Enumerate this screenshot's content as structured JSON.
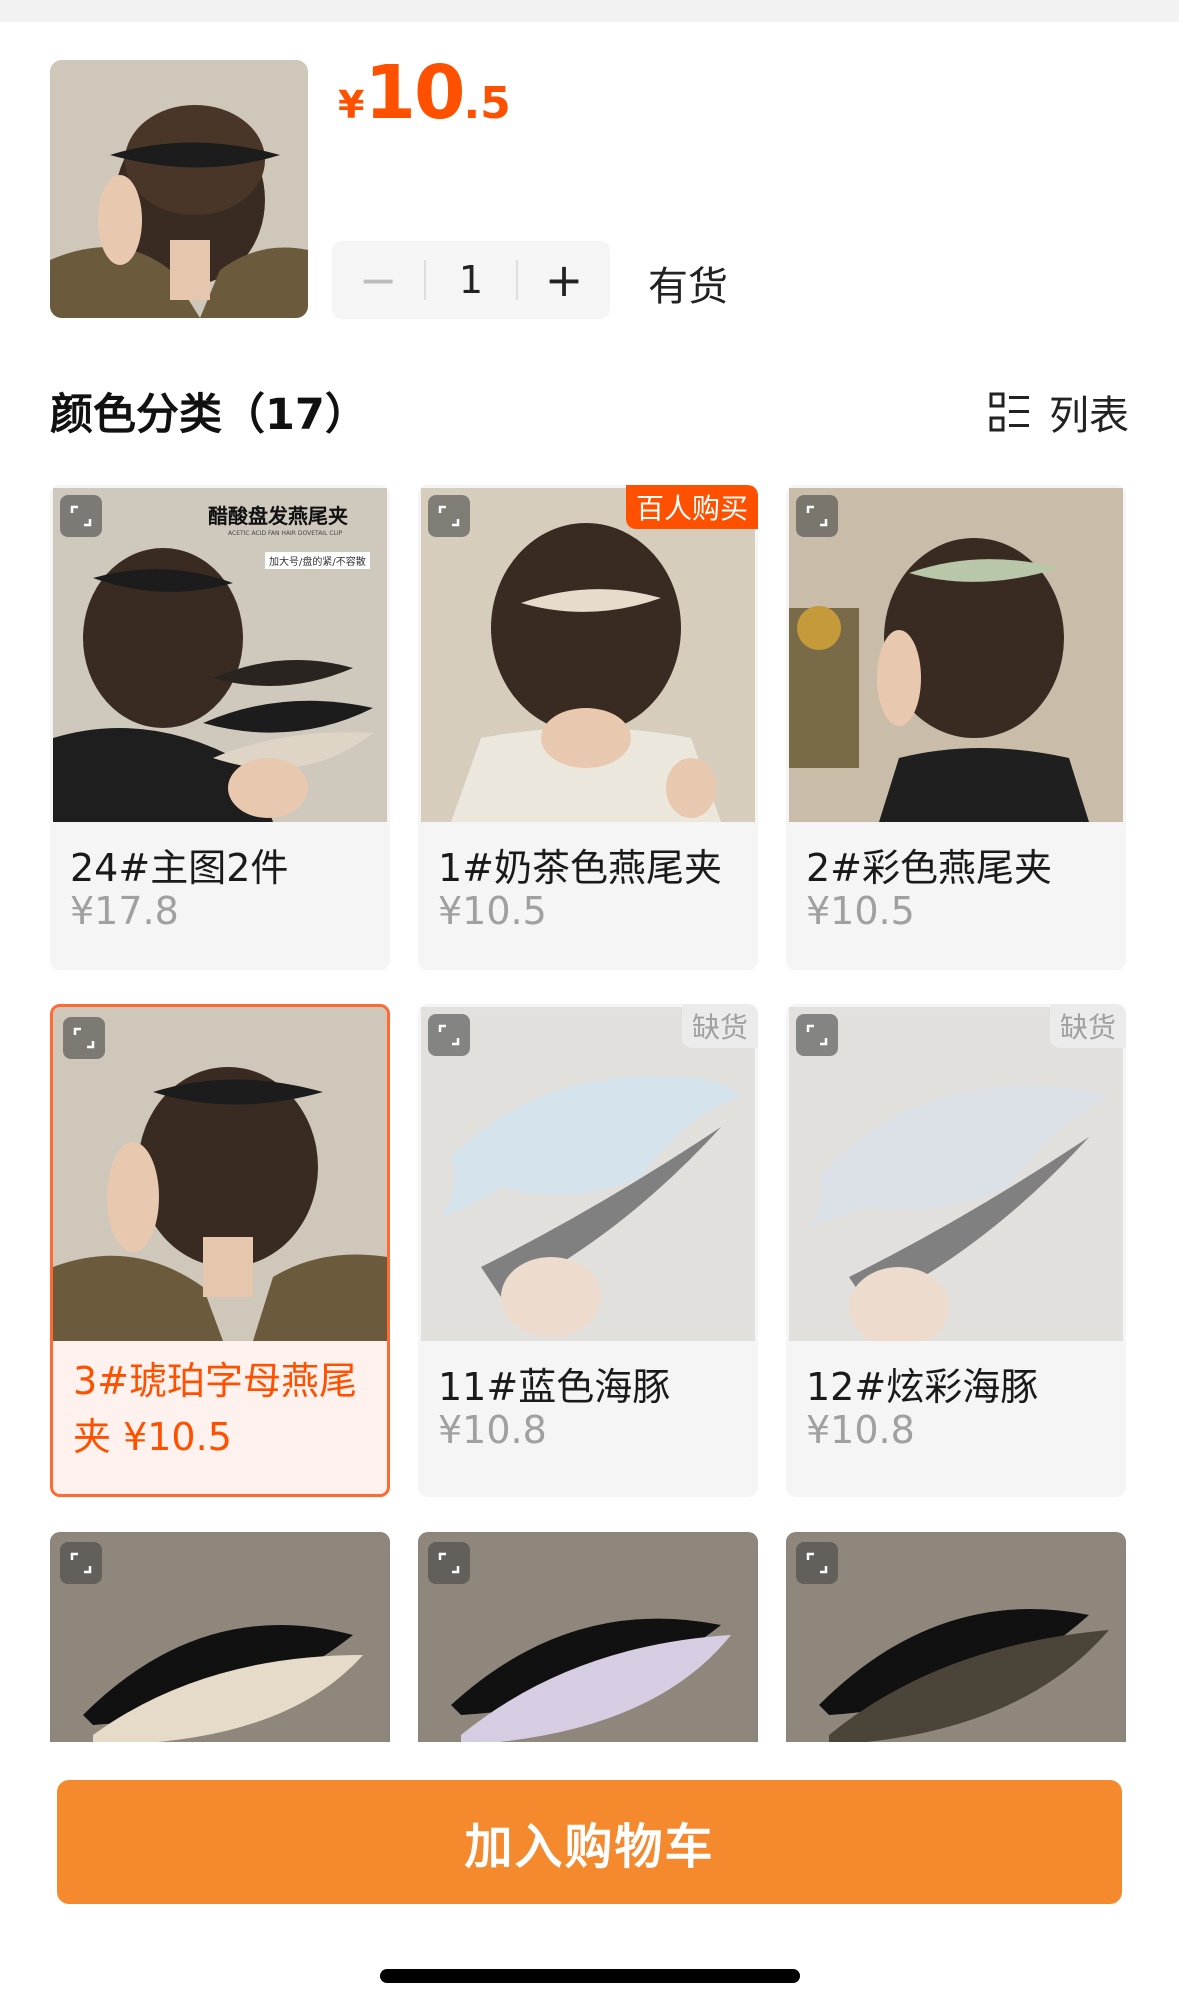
{
  "product": {
    "price_currency": "¥",
    "price_int": "10",
    "price_dec": ".5",
    "quantity": "1",
    "minus_label": "−",
    "plus_label": "+",
    "stock_status": "有货"
  },
  "section": {
    "title": "颜色分类（17）",
    "list_label": "列表",
    "list_icon": "list-icon"
  },
  "options": [
    {
      "name": "24#主图2件",
      "price": "¥17.8",
      "badge": "",
      "state": "normal"
    },
    {
      "name": "1#奶茶色燕尾夹",
      "price": "¥10.5",
      "badge": "百人购买",
      "state": "normal"
    },
    {
      "name": "2#彩色燕尾夹",
      "price": "¥10.5",
      "badge": "",
      "state": "normal"
    },
    {
      "name": "3#琥珀字母燕尾夹 ¥10.5",
      "price": "",
      "badge": "",
      "state": "selected"
    },
    {
      "name": "11#蓝色海豚",
      "price": "¥10.8",
      "badge": "缺货",
      "state": "soldout"
    },
    {
      "name": "12#炫彩海豚",
      "price": "¥10.8",
      "badge": "缺货",
      "state": "soldout"
    }
  ],
  "image1_text": {
    "title": "醋酸盘发燕尾夹",
    "subtitle": "ACETIC ACID FAN HAIR DOVETAIL CLIP",
    "tag": "加大号/盘的紧/不容散"
  },
  "cart_button": "加入购物车",
  "colors": {
    "accent": "#ff5000",
    "button": "#f5892d",
    "muted": "#a0a0a0"
  }
}
